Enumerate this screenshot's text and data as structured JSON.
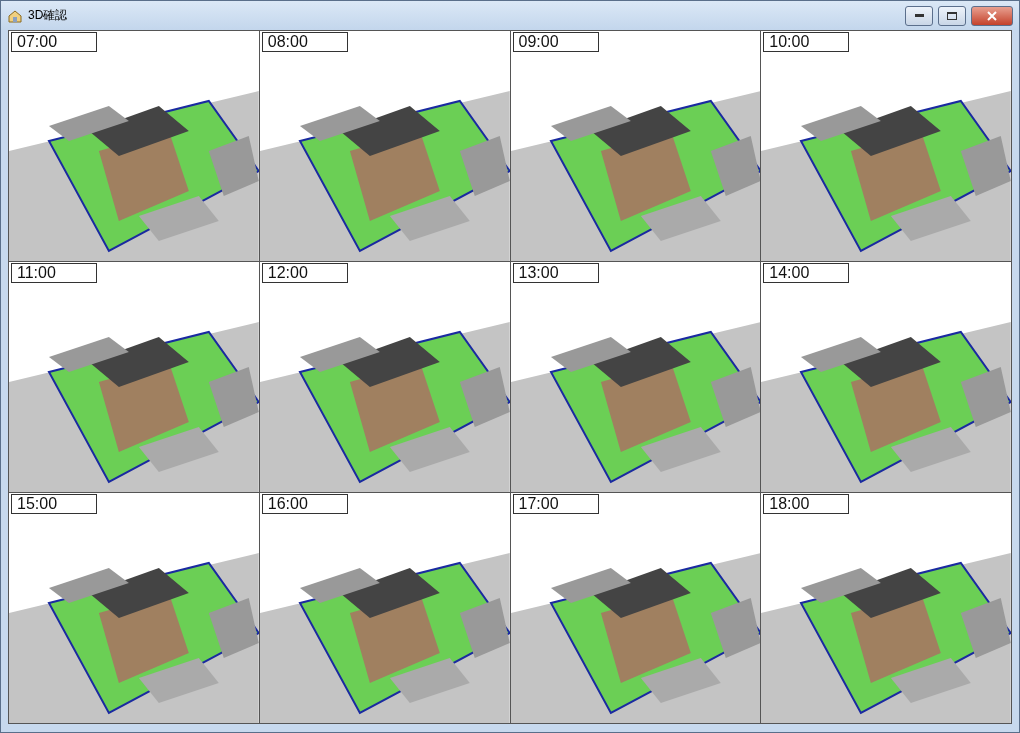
{
  "window": {
    "title": "3D確認"
  },
  "views": [
    {
      "time": "07:00"
    },
    {
      "time": "08:00"
    },
    {
      "time": "09:00"
    },
    {
      "time": "10:00"
    },
    {
      "time": "11:00"
    },
    {
      "time": "12:00"
    },
    {
      "time": "13:00"
    },
    {
      "time": "14:00"
    },
    {
      "time": "15:00"
    },
    {
      "time": "16:00"
    },
    {
      "time": "17:00"
    },
    {
      "time": "18:00"
    }
  ]
}
